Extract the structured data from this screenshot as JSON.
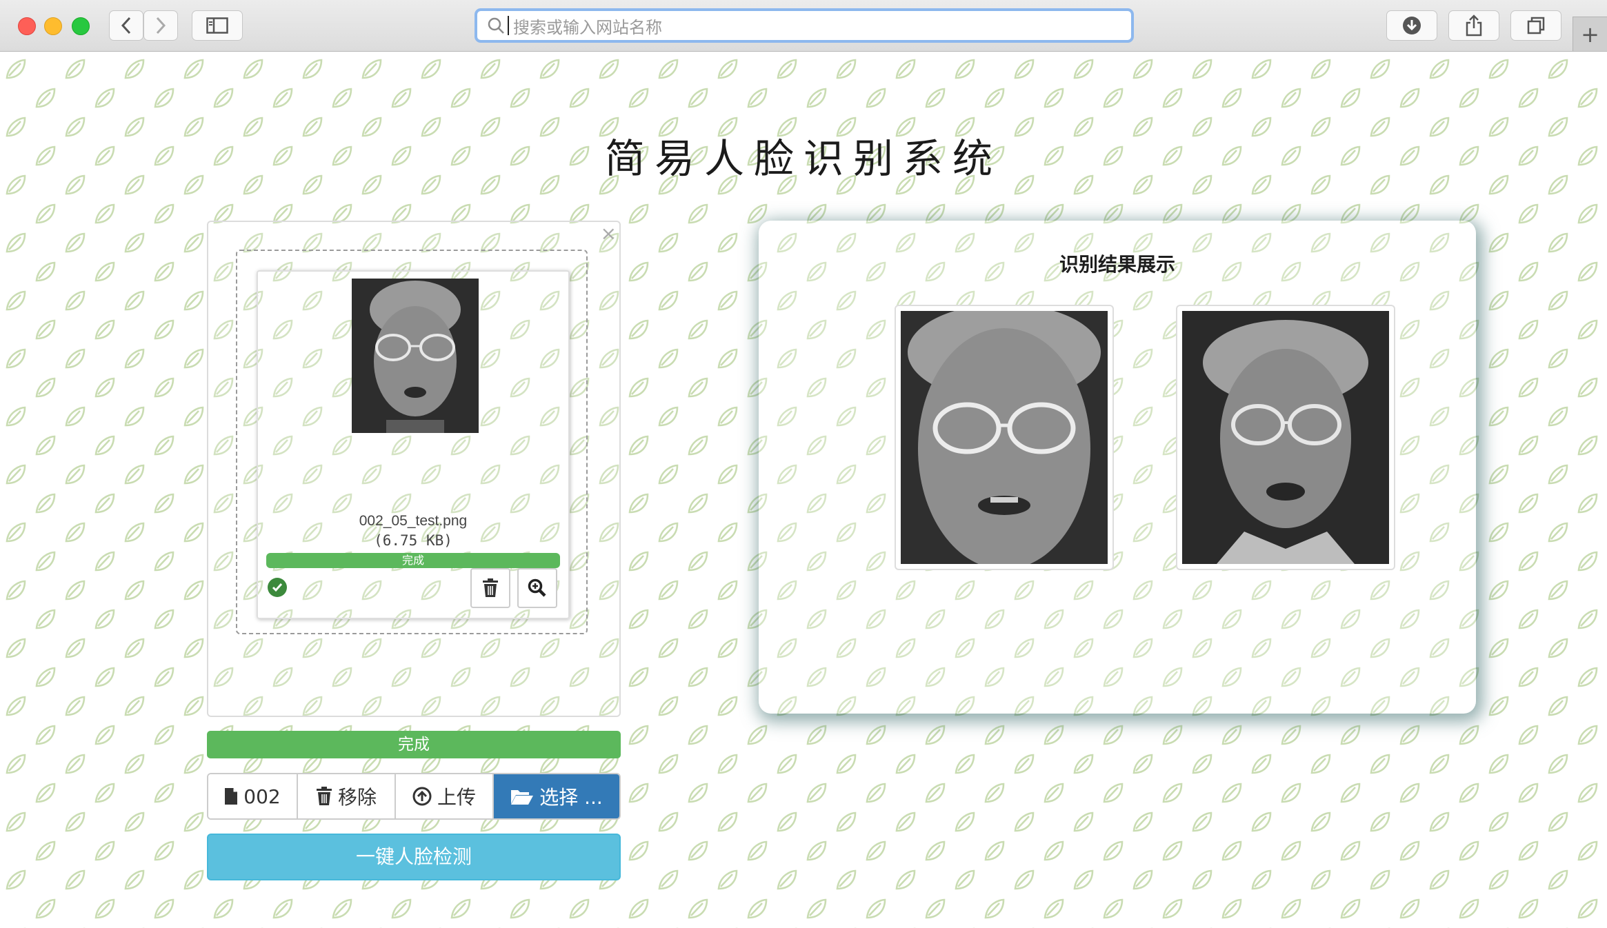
{
  "browser": {
    "address_placeholder": "搜索或输入网站名称"
  },
  "page": {
    "title": "简易人脸识别系统"
  },
  "uploader": {
    "file_name": "002_05_test.png",
    "file_size": "(6.75 KB)",
    "item_status": "完成",
    "overall_status": "完成",
    "progress_fraction": 1.0
  },
  "actions": {
    "file_caption": "002",
    "remove_label": "移除",
    "upload_label": "上传",
    "choose_label": "选择 ...",
    "detect_label": "一键人脸检测"
  },
  "results": {
    "title": "识别结果展示"
  },
  "colors": {
    "success": "#5cb85c",
    "primary": "#337ab7",
    "info": "#5bc0de"
  }
}
